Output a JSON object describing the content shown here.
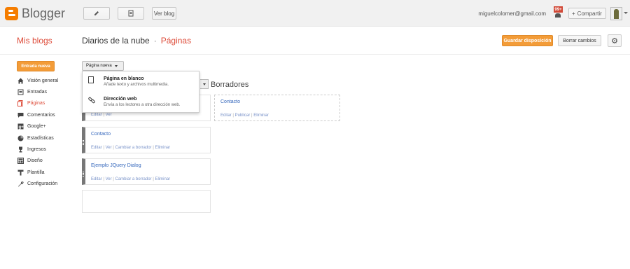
{
  "topbar": {
    "logo": "Blogger",
    "edit_icon": "pencil-icon",
    "pages_icon": "pages-icon",
    "view_blog": "Ver blog",
    "email": "miguelcolomer@gmail.com",
    "notifications_badge": "99+",
    "share_label": "Compartir",
    "share_plus": "+"
  },
  "subheader": {
    "mis_blogs": "Mis blogs",
    "blog_name": "Diarios de la nube",
    "separator": "·",
    "section": "Páginas",
    "save_layout": "Guardar disposición",
    "clear_changes": "Borrar cambios",
    "settings_icon": "gear-icon"
  },
  "sidebar": {
    "new_post": "Entrada nueva",
    "items": [
      {
        "label": "Visión general",
        "icon": "house-icon"
      },
      {
        "label": "Entradas",
        "icon": "posts-icon"
      },
      {
        "label": "Páginas",
        "icon": "pages-icon"
      },
      {
        "label": "Comentarios",
        "icon": "comment-icon"
      },
      {
        "label": "Google+",
        "icon": "google-plus-icon"
      },
      {
        "label": "Estadísticas",
        "icon": "stats-icon"
      },
      {
        "label": "Ingresos",
        "icon": "trophy-icon"
      },
      {
        "label": "Diseño",
        "icon": "layout-icon"
      },
      {
        "label": "Plantilla",
        "icon": "template-icon"
      },
      {
        "label": "Configuración",
        "icon": "wrench-icon"
      }
    ]
  },
  "main": {
    "new_page_button": "Página nueva",
    "drafts_title": "Borradores",
    "dropdown": [
      {
        "title": "Página en blanco",
        "desc": "Añade texto y archivos multimedia."
      },
      {
        "title": "Dirección web",
        "desc": "Envía a los lectores a otra dirección web."
      }
    ],
    "published_cards": [
      {
        "title": "",
        "actions": [
          "Editar",
          "Ver"
        ]
      },
      {
        "title": "Contacto",
        "actions": [
          "Editar",
          "Ver",
          "Cambiar a borrador",
          "Eliminar"
        ]
      },
      {
        "title": "Ejemplo JQuery Dialog",
        "actions": [
          "Editar",
          "Ver",
          "Cambiar a borrador",
          "Eliminar"
        ]
      }
    ],
    "draft_cards": [
      {
        "title": "Contacto",
        "actions": [
          "Editar",
          "Publicar",
          "Eliminar"
        ]
      }
    ],
    "action_separator": "|"
  }
}
